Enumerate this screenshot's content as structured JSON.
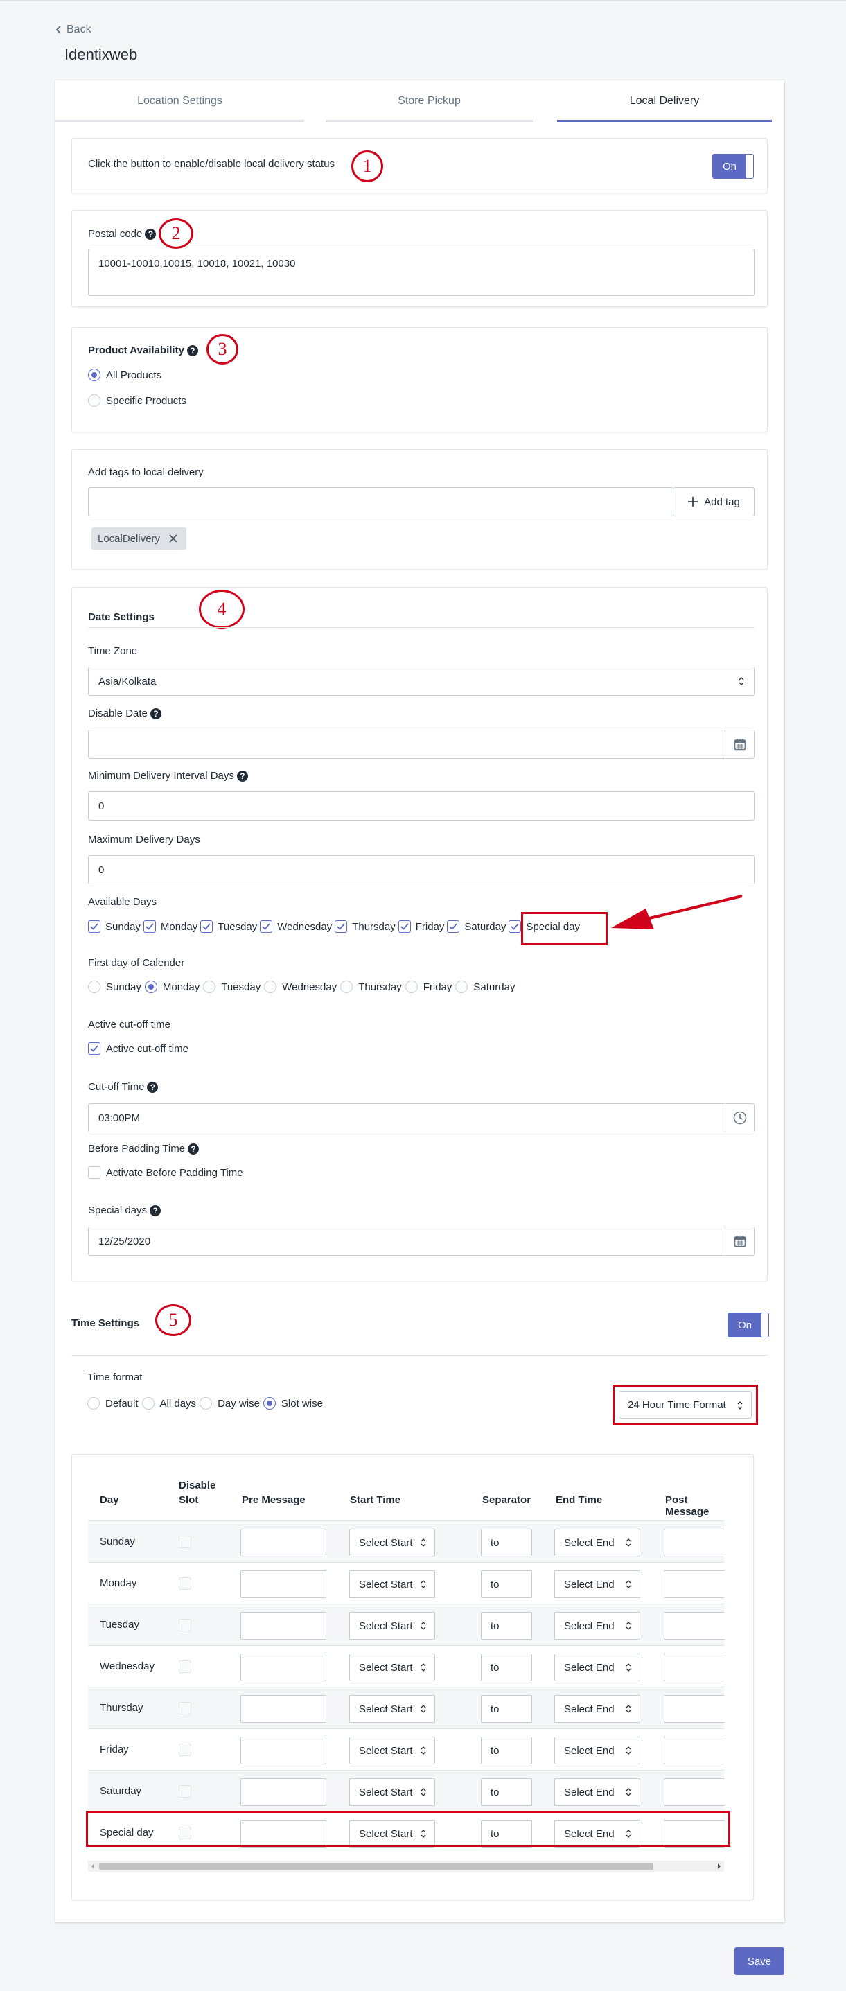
{
  "nav": {
    "back_label": "Back",
    "store_title": "Identixweb"
  },
  "tabs": [
    {
      "label": "Location Settings"
    },
    {
      "label": "Store Pickup"
    },
    {
      "label": "Local Delivery"
    }
  ],
  "status_card": {
    "text": "Click the button to enable/disable local delivery status",
    "toggle_label": "On"
  },
  "postal_card": {
    "label": "Postal code",
    "value": "10001-10010,10015, 10018, 10021, 10030"
  },
  "product_card": {
    "title": "Product Availability",
    "options": [
      {
        "label": "All Products",
        "selected": true
      },
      {
        "label": "Specific Products",
        "selected": false
      }
    ]
  },
  "tags_card": {
    "label": "Add tags to local delivery",
    "input_value": "",
    "add_button": "Add tag",
    "tags": [
      "LocalDelivery"
    ]
  },
  "date_settings": {
    "title": "Date Settings",
    "timezone_label": "Time Zone",
    "timezone_value": "Asia/Kolkata",
    "disable_date_label": "Disable Date",
    "disable_date_value": "",
    "min_interval_label": "Minimum Delivery Interval Days",
    "min_interval_value": "0",
    "max_days_label": "Maximum Delivery Days",
    "max_days_value": "0",
    "available_days_label": "Available Days",
    "available_days": [
      {
        "label": "Sunday",
        "checked": true
      },
      {
        "label": "Monday",
        "checked": true
      },
      {
        "label": "Tuesday",
        "checked": true
      },
      {
        "label": "Wednesday",
        "checked": true
      },
      {
        "label": "Thursday",
        "checked": true
      },
      {
        "label": "Friday",
        "checked": true
      },
      {
        "label": "Saturday",
        "checked": true
      },
      {
        "label": "Special day",
        "checked": true
      }
    ],
    "first_day_label": "First day of Calender",
    "first_day_options": [
      {
        "label": "Sunday",
        "selected": false
      },
      {
        "label": "Monday",
        "selected": true
      },
      {
        "label": "Tuesday",
        "selected": false
      },
      {
        "label": "Wednesday",
        "selected": false
      },
      {
        "label": "Thursday",
        "selected": false
      },
      {
        "label": "Friday",
        "selected": false
      },
      {
        "label": "Saturday",
        "selected": false
      }
    ],
    "cutoff_section_label": "Active cut-off time",
    "cutoff_checkbox_label": "Active cut-off time",
    "cutoff_time_label": "Cut-off Time",
    "cutoff_time_value": "03:00PM",
    "padding_label": "Before Padding Time",
    "padding_checkbox_label": "Activate Before Padding Time",
    "special_days_label": "Special days",
    "special_days_value": "12/25/2020"
  },
  "time_settings": {
    "title": "Time Settings",
    "toggle_label": "On",
    "format_label": "Time format",
    "format_options": [
      {
        "label": "Default",
        "selected": false
      },
      {
        "label": "All days",
        "selected": false
      },
      {
        "label": "Day wise",
        "selected": false
      },
      {
        "label": "Slot wise",
        "selected": true
      }
    ],
    "hour_format": "24 Hour Time Format",
    "table": {
      "headers": {
        "day": "Day",
        "disable_1": "Disable",
        "disable_2": "Slot",
        "pre": "Pre Message",
        "start": "Start Time",
        "sep": "Separator",
        "end": "End Time",
        "post": "Post Message"
      },
      "rows": [
        {
          "day": "Sunday",
          "start": "Select Start",
          "sep": "to",
          "end": "Select End"
        },
        {
          "day": "Monday",
          "start": "Select Start",
          "sep": "to",
          "end": "Select End"
        },
        {
          "day": "Tuesday",
          "start": "Select Start",
          "sep": "to",
          "end": "Select End"
        },
        {
          "day": "Wednesday",
          "start": "Select Start",
          "sep": "to",
          "end": "Select End"
        },
        {
          "day": "Thursday",
          "start": "Select Start",
          "sep": "to",
          "end": "Select End"
        },
        {
          "day": "Friday",
          "start": "Select Start",
          "sep": "to",
          "end": "Select End"
        },
        {
          "day": "Saturday",
          "start": "Select Start",
          "sep": "to",
          "end": "Select End"
        },
        {
          "day": "Special day",
          "start": "Select Start",
          "sep": "to",
          "end": "Select End"
        }
      ]
    }
  },
  "annotations": [
    "1",
    "2",
    "3",
    "4",
    "5"
  ],
  "footer": {
    "save_label": "Save"
  },
  "colors": {
    "accent": "#5c6ac4",
    "annotation": "#d0021b"
  }
}
